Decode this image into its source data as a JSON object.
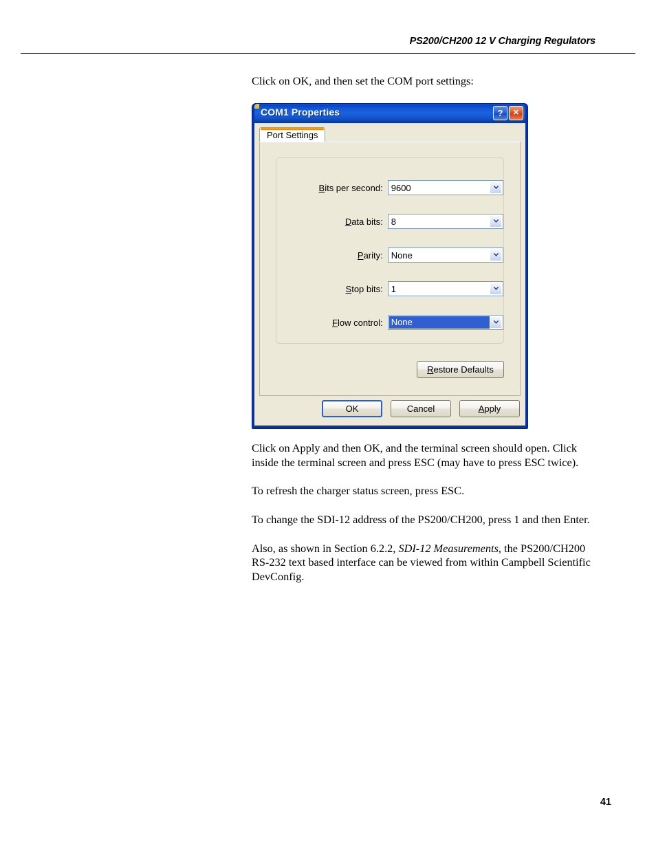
{
  "header": {
    "running_title": "PS200/CH200 12 V Charging Regulators"
  },
  "page_number": "41",
  "body": {
    "intro": "Click on OK, and then set the COM port settings:",
    "para_apply_pre": "Click on Apply and then OK, and the terminal screen should open.  Click inside the terminal screen and press ESC (may have to press ESC twice).",
    "para_refresh": "To refresh the charger status screen, press ESC.",
    "para_sdi_address": "To change the SDI-12 address of the PS200/CH200, press 1 and then Enter.",
    "para_devconfig_pre": "Also, as shown in Section 6.2.2, ",
    "para_devconfig_italic": "SDI-12 Measurements",
    "para_devconfig_post": ", the PS200/CH200 RS-232 text based interface can be viewed from within Campbell Scientific DevConfig."
  },
  "dialog": {
    "title": "COM1 Properties",
    "help_button": "?",
    "close_button": "×",
    "tabs": [
      {
        "label": "Port Settings",
        "active": true
      }
    ],
    "fields": [
      {
        "label_accel": "B",
        "label_rest": "its per second:",
        "value": "9600",
        "selected": false
      },
      {
        "label_accel": "D",
        "label_rest": "ata bits:",
        "value": "8",
        "selected": false
      },
      {
        "label_accel": "P",
        "label_rest": "arity:",
        "value": "None",
        "selected": false
      },
      {
        "label_accel": "S",
        "label_rest": "top bits:",
        "value": "1",
        "selected": false
      },
      {
        "label_accel": "F",
        "label_rest": "low control:",
        "value": "None",
        "selected": true
      }
    ],
    "restore_defaults": {
      "accel": "R",
      "rest": "estore Defaults"
    },
    "buttons": [
      {
        "accel": "",
        "rest": "OK",
        "default": true
      },
      {
        "accel": "",
        "rest": "Cancel",
        "default": false
      },
      {
        "accel": "A",
        "rest": "pply",
        "default": false
      }
    ]
  },
  "colors": {
    "titlebar_blue": "#1a63e0",
    "dialog_frame": "#0a34a5",
    "client_bg": "#ece9d8",
    "selection_blue": "#2f5fd0",
    "tab_accent_orange": "#f5a623",
    "close_button_red": "#e2552a"
  }
}
